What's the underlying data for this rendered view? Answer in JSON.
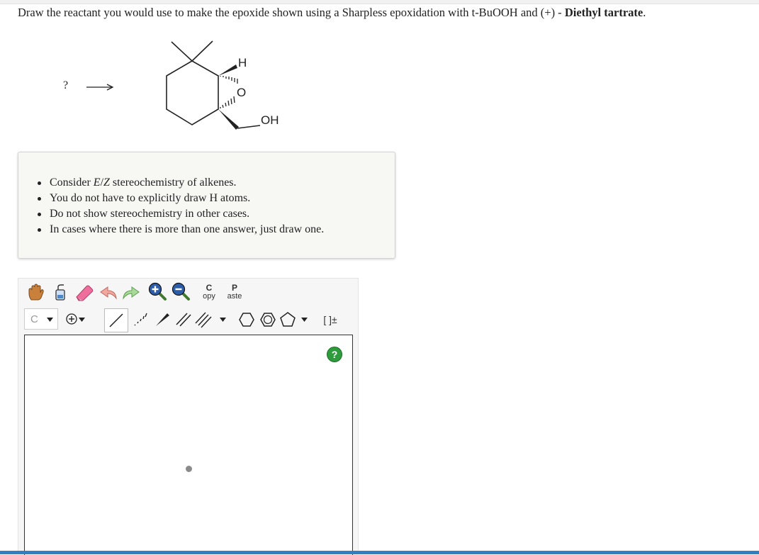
{
  "question": {
    "prefix": "Draw the reactant you would use to make the epoxide shown using a Sharpless epoxidation with t-BuOOH and (+) - ",
    "bold": "Diethyl tartrate",
    "suffix": "."
  },
  "reaction": {
    "unknown_mark": "?",
    "atom_h": "H",
    "atom_o": "O",
    "group_oh": "OH"
  },
  "hints": [
    {
      "text": "Consider E/Z stereochemistry of alkenes."
    },
    {
      "text": "You do not have to explicitly draw H atoms."
    },
    {
      "text": "Do not show stereochemistry in other cases."
    },
    {
      "text": "In cases where there is more than one answer, just draw one."
    }
  ],
  "editor": {
    "copy_big": "C",
    "copy_small": "opy",
    "paste_big": "P",
    "paste_small": "aste",
    "element_selected": "C",
    "bracket_label": "[ ]±",
    "help": "?",
    "icons": [
      "hand-icon",
      "eraser-bottle-icon",
      "eraser-icon",
      "undo-icon",
      "redo-icon",
      "zoom-in-icon",
      "zoom-out-icon",
      "charge-plus-icon",
      "single-bond-icon",
      "hashed-bond-icon",
      "wedge-bond-icon",
      "double-bond-icon",
      "triple-bond-icon",
      "cyclohexane-icon",
      "benzene-icon",
      "cyclopentane-icon"
    ]
  }
}
